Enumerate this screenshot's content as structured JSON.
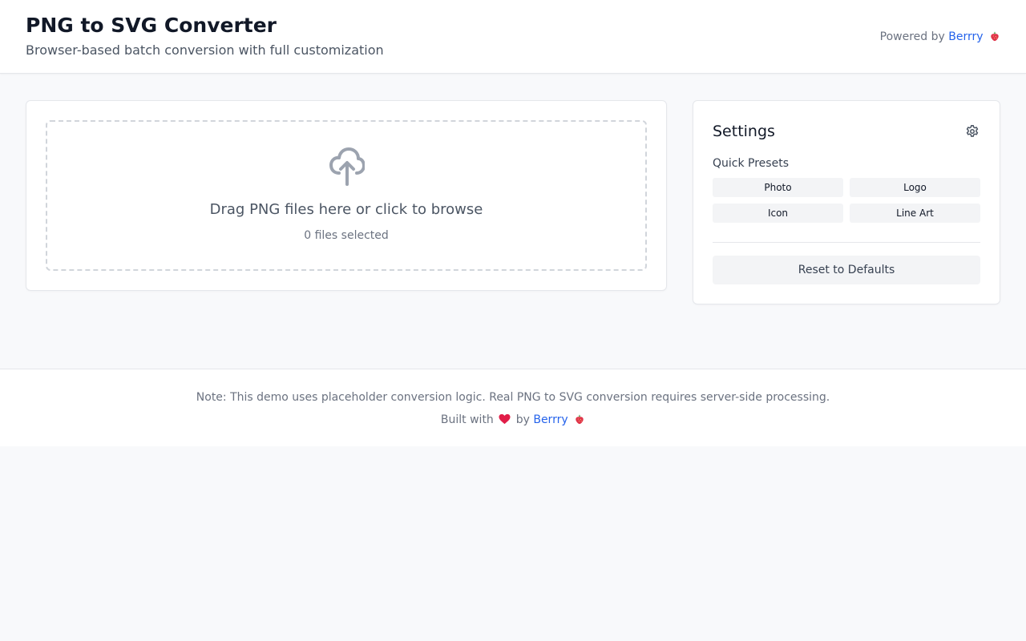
{
  "header": {
    "title": "PNG to SVG Converter",
    "subtitle": "Browser-based batch conversion with full customization",
    "powered_by_prefix": "Powered by",
    "powered_by_link": "Berrry"
  },
  "upload": {
    "icon": "cloud-upload-icon",
    "drop_text": "Drag PNG files here or click to browse",
    "file_count": "0 files selected"
  },
  "settings": {
    "title": "Settings",
    "icon": "gear-icon",
    "presets_label": "Quick Presets",
    "presets": [
      "Photo",
      "Logo",
      "Icon",
      "Line Art"
    ],
    "reset_label": "Reset to Defaults"
  },
  "footer": {
    "note": "Note: This demo uses placeholder conversion logic. Real PNG to SVG conversion requires server-side processing.",
    "built_prefix": "Built with",
    "built_by": "by",
    "built_link": "Berrry"
  },
  "colors": {
    "link": "#2563eb",
    "background": "#f8f9fb",
    "heart": "#e11d48"
  }
}
